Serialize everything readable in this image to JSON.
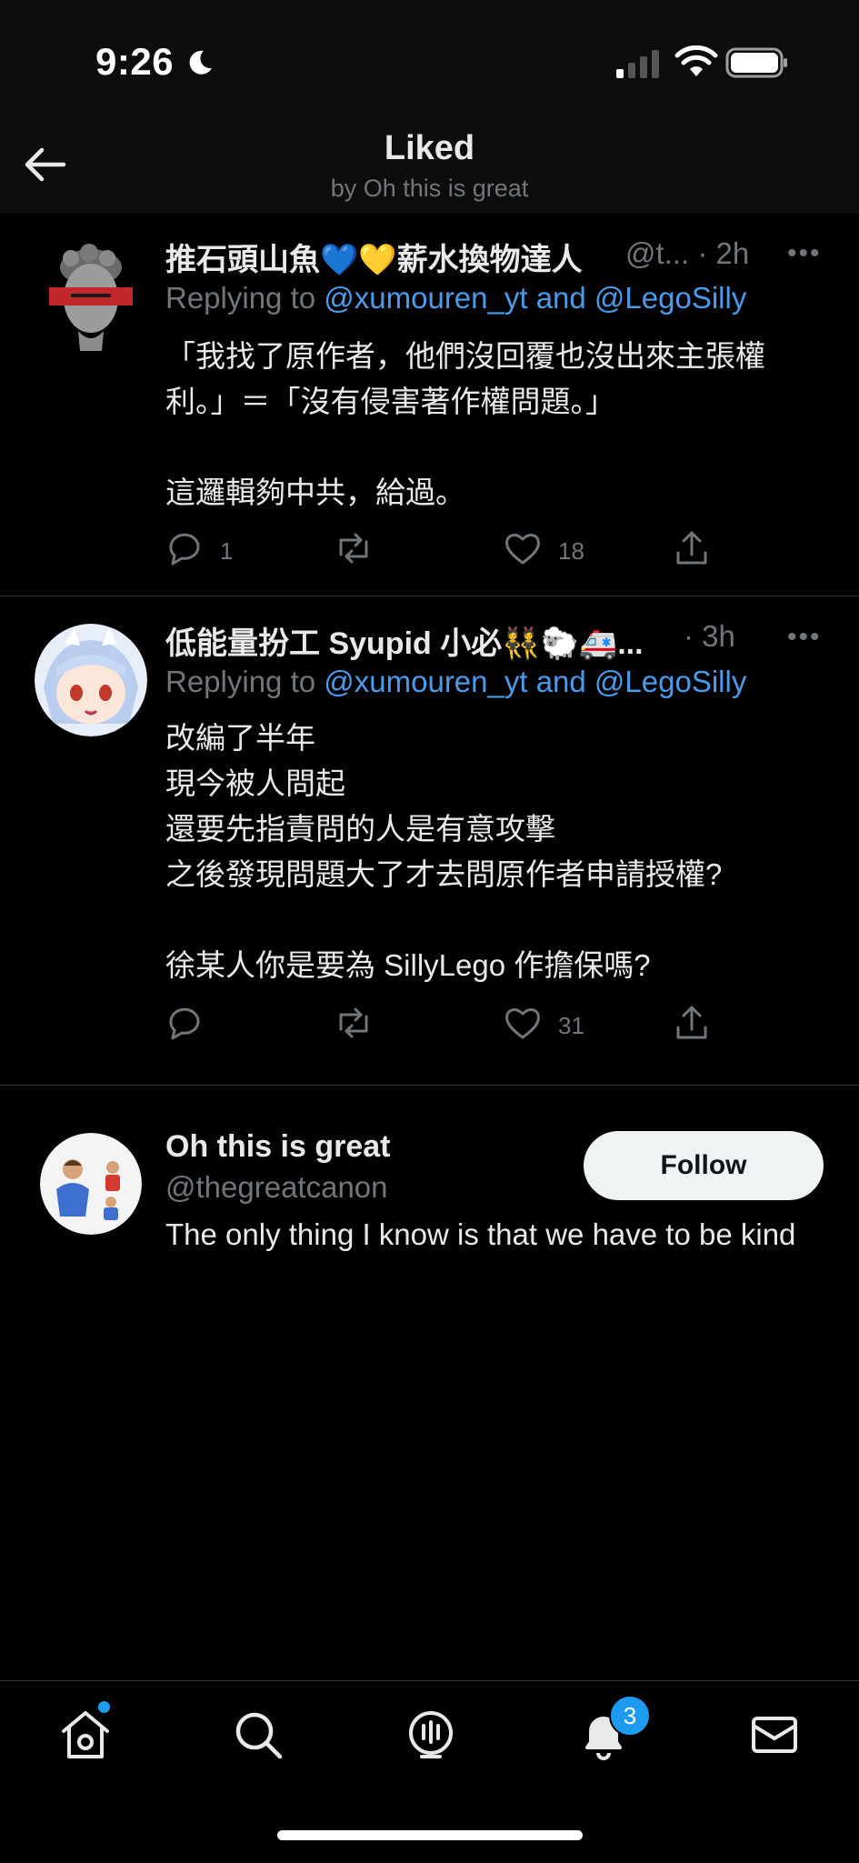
{
  "status_bar": {
    "time": "9:26"
  },
  "header": {
    "title": "Liked",
    "subtitle": "by Oh this is great"
  },
  "tweets": [
    {
      "name": "推石頭山魚💙💛薪水換物達人",
      "handle_time": "@t... · 2h",
      "replying_prefix": "Replying to ",
      "replying_to": "@xumouren_yt and @LegoSilly",
      "text": "「我找了原作者，他們沒回覆也沒出來主張權利。」＝「沒有侵害著作權問題。」\n\n這邏輯夠中共，給過。",
      "replies": "1",
      "retweets": "",
      "likes": "18"
    },
    {
      "name": "低能量扮工 Syupid 小必👯🐑🚑...",
      "handle_time": "· 3h",
      "replying_prefix": "Replying to ",
      "replying_to": "@xumouren_yt and @LegoSilly",
      "text": "改編了半年\n現今被人問起\n還要先指責問的人是有意攻擊\n之後發現問題大了才去問原作者申請授權?\n\n徐某人你是要為 SillyLego 作擔保嗎?",
      "replies": "",
      "retweets": "",
      "likes": "31"
    }
  ],
  "liker": {
    "name": "Oh this is great",
    "handle": "@thegreatcanon",
    "bio": "The only thing I know is that we have to be kind",
    "follow_label": "Follow"
  },
  "tabbar": {
    "notifications_badge": "3"
  },
  "colors": {
    "accent": "#1d9bf0",
    "link": "#4a9bea",
    "muted": "#71767b",
    "background": "#000000"
  }
}
